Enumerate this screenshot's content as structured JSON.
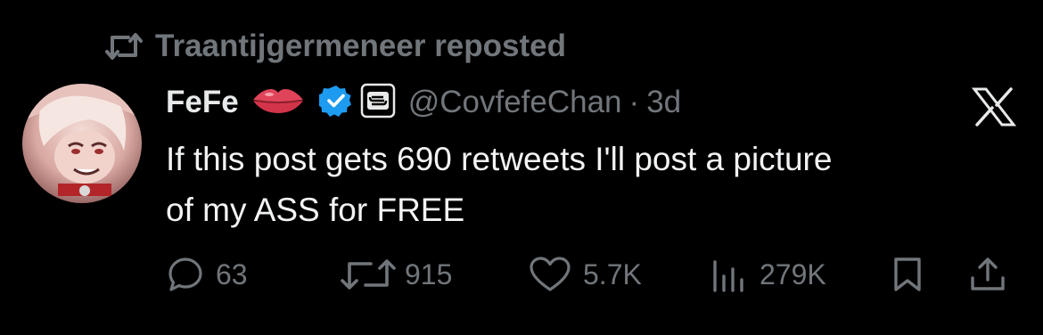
{
  "repost": {
    "text": "Traantijgermeneer reposted",
    "icon": "repost-icon"
  },
  "author": {
    "display_name": "FeFe",
    "emoji_icon": "lips-emoji-icon",
    "verified_icon": "verified-badge-icon",
    "affiliate_badge_icon": "affiliate-badge-icon",
    "handle": "@CovfefeChan",
    "separator": "·",
    "time": "3d",
    "avatar_icon": "avatar-image"
  },
  "platform": {
    "logo_icon": "x-logo-icon"
  },
  "post": {
    "line1": "If this post gets 690 retweets I'll post a picture",
    "line2": "of my ASS for FREE"
  },
  "actions": {
    "replies": {
      "icon": "reply-icon",
      "count": "63"
    },
    "reposts": {
      "icon": "repost-icon",
      "count": "915"
    },
    "likes": {
      "icon": "heart-icon",
      "count": "5.7K"
    },
    "views": {
      "icon": "analytics-icon",
      "count": "279K"
    },
    "bookmark": {
      "icon": "bookmark-icon"
    },
    "share": {
      "icon": "share-icon"
    }
  },
  "colors": {
    "background": "#000000",
    "primary_text": "#e7e9ea",
    "secondary_text": "#71767b",
    "verified_blue": "#1d9bf0"
  }
}
